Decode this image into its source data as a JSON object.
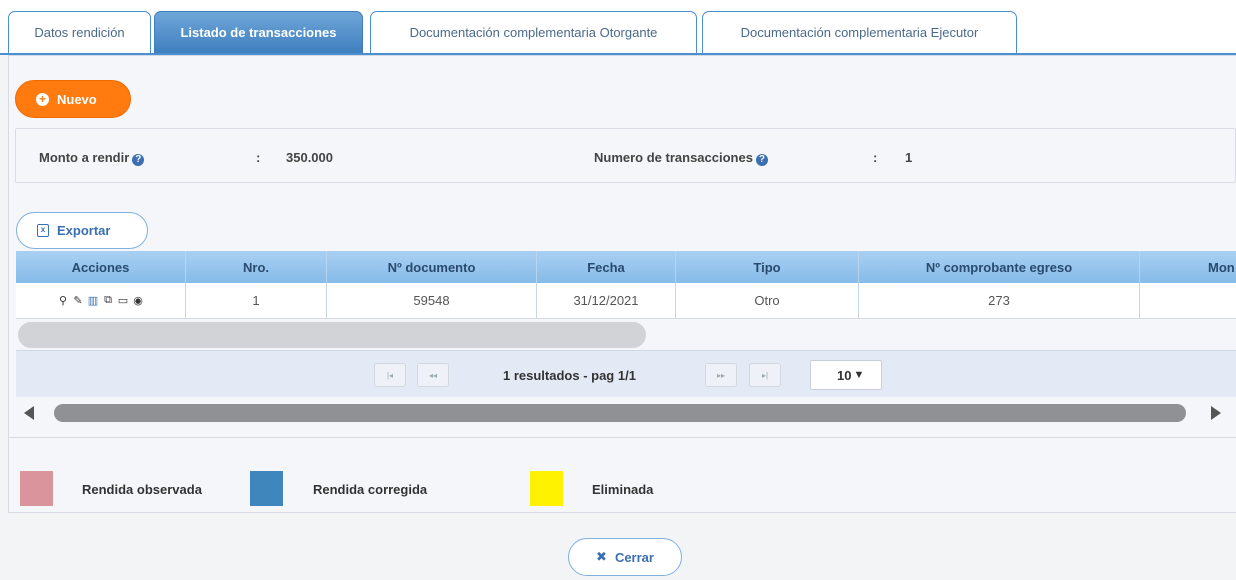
{
  "tabs": [
    {
      "label": "Datos rendición",
      "active": false
    },
    {
      "label": "Listado de transacciones",
      "active": true
    },
    {
      "label": "Documentación complementaria Otorgante",
      "active": false
    },
    {
      "label": "Documentación complementaria Ejecutor",
      "active": false
    }
  ],
  "toolbar": {
    "nuevo_label": "Nuevo",
    "exportar_label": "Exportar",
    "cerrar_label": "Cerrar"
  },
  "summary": {
    "monto_label": "Monto a rendir",
    "monto_sep": ":",
    "monto_value": "350.000",
    "numero_label": "Numero de transacciones",
    "numero_sep": ":",
    "numero_value": "1"
  },
  "table": {
    "columns": [
      "Acciones",
      "Nro.",
      "Nº documento",
      "Fecha",
      "Tipo",
      "Nº comprobante egreso",
      "Mon"
    ],
    "rows": [
      {
        "nro": "1",
        "documento": "59548",
        "fecha": "31/12/2021",
        "tipo": "Otro",
        "comprobante": "273",
        "monto": ""
      }
    ],
    "action_icons": [
      "search-icon",
      "edit-icon",
      "delete-icon",
      "copy-icon",
      "comment-icon",
      "view-icon"
    ]
  },
  "pager": {
    "first": "|◂",
    "prev": "◂◂",
    "next": "▸▸",
    "last": "▸|",
    "status": "1 resultados - pag 1/1",
    "page_size": "10"
  },
  "legend": [
    {
      "label": "Rendida observada",
      "color": "#d9959b"
    },
    {
      "label": "Rendida corregida",
      "color": "#3f86bd"
    },
    {
      "label": "Eliminada",
      "color": "#fff200"
    }
  ],
  "colors": {
    "accent_orange": "#ff7a0f",
    "header_blue": "#86bbe9",
    "tab_active": "#3f7fc0"
  }
}
